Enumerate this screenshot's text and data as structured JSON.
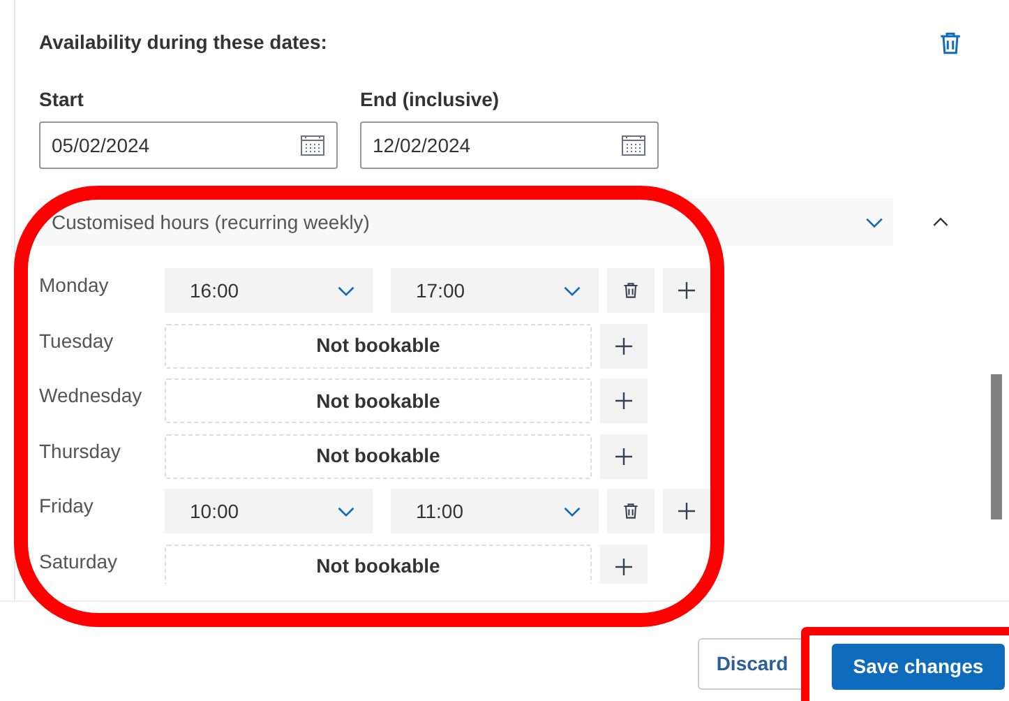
{
  "section": {
    "title": "Availability during these dates:"
  },
  "dates": [
    {
      "label": "Start",
      "value": "05/02/2024"
    },
    {
      "label": "End (inclusive)",
      "value": "12/02/2024"
    }
  ],
  "hours_select": {
    "value": "Customised hours (recurring weekly)",
    "expanded": true
  },
  "days": [
    {
      "day": "Monday",
      "kind": "hours",
      "start": "16:00",
      "end": "17:00"
    },
    {
      "day": "Tuesday",
      "kind": "closed",
      "text": "Not bookable"
    },
    {
      "day": "Wednesday",
      "kind": "closed",
      "text": "Not bookable"
    },
    {
      "day": "Thursday",
      "kind": "closed",
      "text": "Not bookable"
    },
    {
      "day": "Friday",
      "kind": "hours",
      "start": "10:00",
      "end": "11:00"
    },
    {
      "day": "Saturday",
      "kind": "closed",
      "text": "Not bookable"
    }
  ],
  "buttons": [
    {
      "label": "Discard",
      "kind": "secondary"
    },
    {
      "label": "Save changes",
      "kind": "primary"
    }
  ]
}
